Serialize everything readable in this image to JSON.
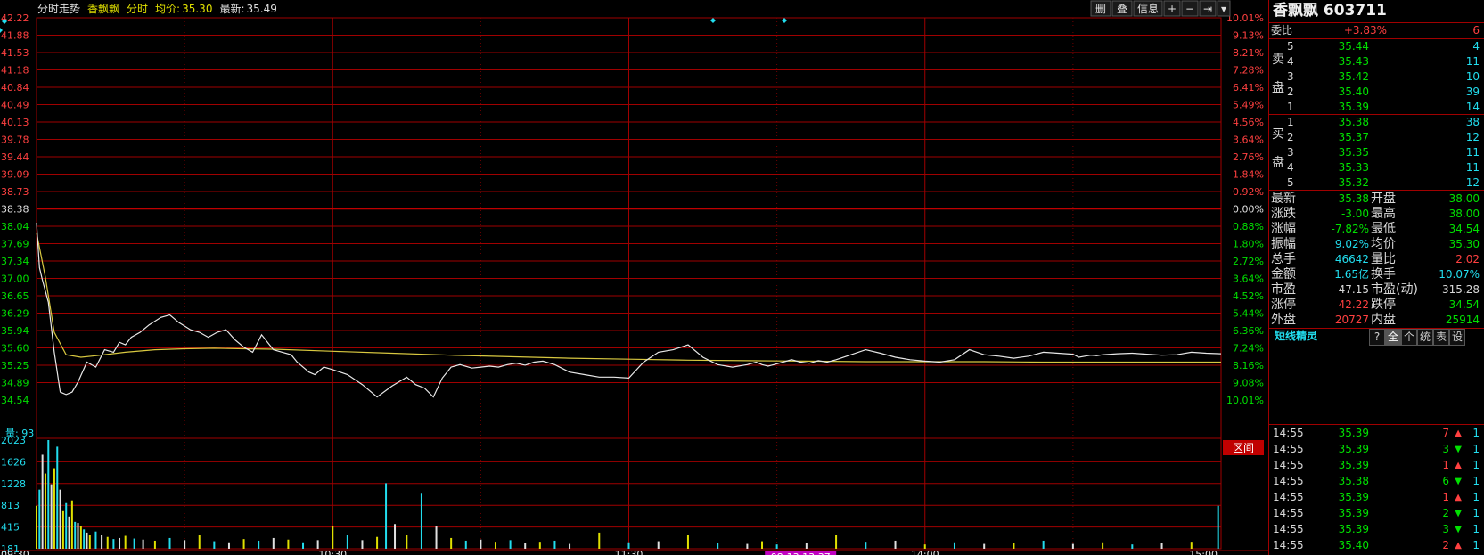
{
  "header": {
    "tab_label": "分时走势",
    "stock_name": "香飘飘",
    "mode_label": "分时",
    "avg_label": "均价:",
    "avg_value": "35.30",
    "latest_label": "最新:",
    "latest_value": "35.49",
    "buttons": [
      "删",
      "叠",
      "信息",
      "+",
      "−",
      "⇥",
      "▾"
    ]
  },
  "chart_data": {
    "type": "line",
    "title": "",
    "y_price_range": [
      34.54,
      42.22
    ],
    "prev_close": 38.38,
    "price_ticks": [
      "42.22",
      "41.88",
      "41.53",
      "41.18",
      "40.84",
      "40.49",
      "40.13",
      "39.78",
      "39.44",
      "39.09",
      "38.73",
      "38.38",
      "38.04",
      "37.69",
      "37.34",
      "37.00",
      "36.65",
      "36.29",
      "35.94",
      "35.60",
      "35.25",
      "34.89",
      "34.54"
    ],
    "pct_ticks": [
      "10.01%",
      "9.13%",
      "8.21%",
      "7.28%",
      "6.41%",
      "5.49%",
      "4.56%",
      "3.64%",
      "2.76%",
      "1.84%",
      "0.92%",
      "0.00%",
      "0.88%",
      "1.80%",
      "2.72%",
      "3.64%",
      "4.52%",
      "5.44%",
      "6.36%",
      "7.24%",
      "8.16%",
      "9.08%",
      "10.01%"
    ],
    "time_labels": [
      "09:30",
      "10:30",
      "11:30",
      "14:00",
      "15:00"
    ],
    "cursor_label": "08-13 13:37",
    "volume_label": "量: 93",
    "volume_ticks": [
      "2023",
      "1626",
      "1228",
      "813",
      "415",
      "181"
    ],
    "volume_range": [
      0,
      2023
    ],
    "corner_label": "区间",
    "series": [
      {
        "key": "price",
        "color": "#e8e8e8",
        "x": [
          0,
          1,
          2,
          4,
          6,
          8,
          10,
          12,
          14,
          17,
          20,
          23,
          26,
          28,
          30,
          32,
          35,
          38,
          42,
          45,
          48,
          52,
          55,
          58,
          61,
          64,
          67,
          70,
          73,
          76,
          80,
          83,
          86,
          88,
          90,
          92,
          94,
          97,
          100,
          105,
          110,
          115,
          120,
          125,
          128,
          131,
          134,
          137,
          140,
          143,
          147,
          150,
          153,
          156,
          159,
          162,
          165,
          168,
          171,
          175,
          180,
          185,
          190,
          195,
          200,
          205,
          210,
          215,
          220,
          225,
          230,
          235,
          240,
          243,
          245,
          247,
          249,
          252,
          255,
          258,
          261,
          264,
          267,
          270,
          275,
          280,
          285,
          290,
          295,
          300,
          305,
          310,
          315,
          320,
          325,
          330,
          335,
          340,
          345,
          350,
          352,
          354,
          356,
          358,
          360,
          365,
          370,
          375,
          380,
          385,
          390,
          395,
          400
        ],
        "y": [
          38.1,
          37.2,
          36.95,
          36.5,
          35.5,
          34.7,
          34.65,
          34.7,
          34.9,
          35.3,
          35.2,
          35.55,
          35.5,
          35.7,
          35.65,
          35.8,
          35.9,
          36.05,
          36.2,
          36.25,
          36.1,
          35.95,
          35.9,
          35.8,
          35.9,
          35.95,
          35.75,
          35.6,
          35.5,
          35.85,
          35.55,
          35.5,
          35.45,
          35.3,
          35.2,
          35.1,
          35.05,
          35.2,
          35.15,
          35.05,
          34.85,
          34.6,
          34.82,
          35.0,
          34.85,
          34.78,
          34.6,
          34.98,
          35.2,
          35.25,
          35.18,
          35.2,
          35.22,
          35.2,
          35.25,
          35.28,
          35.24,
          35.3,
          35.32,
          35.25,
          35.1,
          35.05,
          35.0,
          35.0,
          34.98,
          35.3,
          35.5,
          35.55,
          35.65,
          35.4,
          35.25,
          35.2,
          35.25,
          35.3,
          35.25,
          35.22,
          35.25,
          35.3,
          35.35,
          35.3,
          35.28,
          35.33,
          35.3,
          35.35,
          35.45,
          35.55,
          35.48,
          35.4,
          35.35,
          35.32,
          35.3,
          35.35,
          35.55,
          35.45,
          35.42,
          35.38,
          35.42,
          35.5,
          35.48,
          35.46,
          35.4,
          35.42,
          35.44,
          35.43,
          35.45,
          35.47,
          35.48,
          35.46,
          35.44,
          35.45,
          35.5,
          35.48,
          35.47
        ]
      },
      {
        "key": "average",
        "color": "#d8c840",
        "x": [
          0,
          3,
          6,
          10,
          15,
          20,
          30,
          40,
          50,
          60,
          70,
          80,
          100,
          120,
          140,
          160,
          180,
          200,
          220,
          240,
          260,
          280,
          300,
          320,
          340,
          360,
          380,
          400
        ],
        "y": [
          37.9,
          37.0,
          35.9,
          35.45,
          35.4,
          35.43,
          35.5,
          35.55,
          35.57,
          35.58,
          35.57,
          35.56,
          35.52,
          35.48,
          35.44,
          35.41,
          35.38,
          35.36,
          35.34,
          35.33,
          35.32,
          35.31,
          35.31,
          35.31,
          35.3,
          35.3,
          35.3,
          35.3
        ]
      },
      {
        "key": "volume",
        "x": [
          0,
          1,
          2,
          3,
          4,
          5,
          6,
          7,
          8,
          9,
          10,
          11,
          12,
          13,
          14,
          15,
          16,
          17,
          18,
          20,
          22,
          24,
          26,
          28,
          30,
          33,
          36,
          40,
          45,
          50,
          55,
          60,
          65,
          70,
          75,
          80,
          85,
          90,
          95,
          100,
          105,
          110,
          115,
          118,
          121,
          125,
          130,
          135,
          140,
          145,
          150,
          155,
          160,
          165,
          170,
          175,
          180,
          190,
          200,
          210,
          220,
          230,
          240,
          245,
          250,
          260,
          270,
          280,
          290,
          300,
          310,
          320,
          330,
          340,
          350,
          360,
          370,
          380,
          390,
          399
        ],
        "y": [
          800,
          1100,
          1750,
          1400,
          2023,
          1200,
          1500,
          1900,
          1100,
          700,
          850,
          600,
          900,
          500,
          480,
          420,
          360,
          300,
          250,
          320,
          260,
          220,
          180,
          200,
          240,
          190,
          170,
          150,
          200,
          160,
          260,
          140,
          120,
          180,
          150,
          200,
          170,
          120,
          160,
          420,
          250,
          160,
          220,
          1220,
          460,
          260,
          1040,
          420,
          200,
          150,
          170,
          130,
          160,
          110,
          130,
          150,
          90,
          300,
          120,
          140,
          260,
          110,
          90,
          140,
          80,
          100,
          260,
          130,
          150,
          80,
          120,
          90,
          110,
          150,
          90,
          120,
          80,
          100,
          130,
          800
        ]
      }
    ]
  },
  "panel": {
    "title": "香飘飘 603711",
    "weibi_label": "委比",
    "weibi_value": "+3.83%",
    "weibi_count": "6",
    "sell_side_chars": [
      "卖",
      "盘"
    ],
    "buy_side_chars": [
      "买",
      "盘"
    ],
    "sell_orders": [
      {
        "level": "5",
        "price": "35.44",
        "qty": "4"
      },
      {
        "level": "4",
        "price": "35.43",
        "qty": "11"
      },
      {
        "level": "3",
        "price": "35.42",
        "qty": "10"
      },
      {
        "level": "2",
        "price": "35.40",
        "qty": "39"
      },
      {
        "level": "1",
        "price": "35.39",
        "qty": "14"
      }
    ],
    "buy_orders": [
      {
        "level": "1",
        "price": "35.38",
        "qty": "38"
      },
      {
        "level": "2",
        "price": "35.37",
        "qty": "12"
      },
      {
        "level": "3",
        "price": "35.35",
        "qty": "11"
      },
      {
        "level": "4",
        "price": "35.33",
        "qty": "11"
      },
      {
        "level": "5",
        "price": "35.32",
        "qty": "12"
      }
    ],
    "stats": [
      {
        "l1": "最新",
        "v1": "35.38",
        "c1": "g",
        "l2": "开盘",
        "v2": "38.00",
        "c2": "g"
      },
      {
        "l1": "涨跌",
        "v1": "-3.00",
        "c1": "g",
        "l2": "最高",
        "v2": "38.00",
        "c2": "g"
      },
      {
        "l1": "涨幅",
        "v1": "-7.82%",
        "c1": "g",
        "l2": "最低",
        "v2": "34.54",
        "c2": "g"
      },
      {
        "l1": "振幅",
        "v1": "9.02%",
        "c1": "c",
        "l2": "均价",
        "v2": "35.30",
        "c2": "g"
      },
      {
        "l1": "总手",
        "v1": "46642",
        "c1": "c",
        "l2": "量比",
        "v2": "2.02",
        "c2": "r"
      },
      {
        "l1": "金额",
        "v1": "1.65亿",
        "c1": "c",
        "l2": "换手",
        "v2": "10.07%",
        "c2": "c"
      },
      {
        "l1": "市盈",
        "v1": "47.15",
        "c1": "w",
        "l2": "市盈(动)",
        "v2": "315.28",
        "c2": "w"
      },
      {
        "l1": "涨停",
        "v1": "42.22",
        "c1": "r",
        "l2": "跌停",
        "v2": "34.54",
        "c2": "g"
      },
      {
        "l1": "外盘",
        "v1": "20727",
        "c1": "r",
        "l2": "内盘",
        "v2": "25914",
        "c2": "g"
      }
    ],
    "wizard_label": "短线精灵",
    "wizard_buttons": [
      "?",
      "全",
      "个",
      "统",
      "表",
      "设"
    ],
    "ticks": [
      {
        "time": "14:55",
        "price": "35.39",
        "vol": "7",
        "dir": "up",
        "n": "1"
      },
      {
        "time": "14:55",
        "price": "35.39",
        "vol": "3",
        "dir": "down",
        "n": "1"
      },
      {
        "time": "14:55",
        "price": "35.39",
        "vol": "1",
        "dir": "up",
        "n": "1"
      },
      {
        "time": "14:55",
        "price": "35.38",
        "vol": "6",
        "dir": "down",
        "n": "1"
      },
      {
        "time": "14:55",
        "price": "35.39",
        "vol": "1",
        "dir": "up",
        "n": "1"
      },
      {
        "time": "14:55",
        "price": "35.39",
        "vol": "2",
        "dir": "down",
        "n": "1"
      },
      {
        "time": "14:55",
        "price": "35.39",
        "vol": "3",
        "dir": "down",
        "n": "1"
      },
      {
        "time": "14:55",
        "price": "35.40",
        "vol": "2",
        "dir": "up",
        "n": "1"
      }
    ]
  }
}
